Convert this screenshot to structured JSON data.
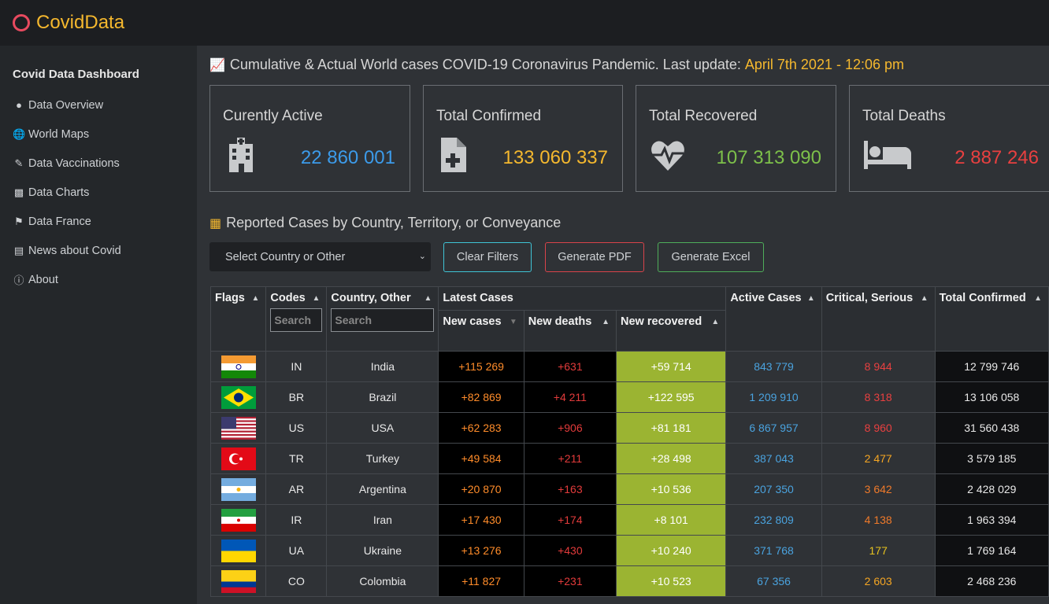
{
  "app": {
    "brand": "CovidData"
  },
  "sidebar": {
    "title": "Covid Data Dashboard",
    "items": [
      {
        "label": "Data Overview",
        "icon": "pills-icon"
      },
      {
        "label": "World Maps",
        "icon": "globe-icon"
      },
      {
        "label": "Data Vaccinations",
        "icon": "syringe-icon"
      },
      {
        "label": "Data Charts",
        "icon": "chart-bar-icon"
      },
      {
        "label": "Data France",
        "icon": "flag-icon"
      },
      {
        "label": "News about Covid",
        "icon": "newspaper-icon"
      },
      {
        "label": "About",
        "icon": "info-icon"
      }
    ]
  },
  "headline": {
    "text": "Cumulative & Actual World cases COVID-19 Coronavirus Pandemic. Last update:",
    "date": "April 7th 2021 - 12:06 pm"
  },
  "cards": [
    {
      "title": "Curently Active",
      "value": "22 860 001",
      "color": "#3c9bea",
      "icon": "hospital-icon"
    },
    {
      "title": "Total Confirmed",
      "value": "133 060 337",
      "color": "#f5b82e",
      "icon": "file-medical-icon"
    },
    {
      "title": "Total Recovered",
      "value": "107 313 090",
      "color": "#7dc04a",
      "icon": "heartbeat-icon"
    },
    {
      "title": "Total Deaths",
      "value": "2 887 246",
      "color": "#e84040",
      "icon": "bed-icon"
    }
  ],
  "section": {
    "title": "Reported Cases by Country, Territory, or Conveyance"
  },
  "controls": {
    "select_placeholder": "Select Country or Other",
    "clear_filters": "Clear Filters",
    "generate_pdf": "Generate PDF",
    "generate_excel": "Generate Excel"
  },
  "table": {
    "headers": {
      "flags": "Flags",
      "codes": "Codes",
      "country": "Country, Other",
      "latest": "Latest Cases",
      "new_cases": "New cases",
      "new_deaths": "New deaths",
      "new_recovered": "New recovered",
      "active": "Active Cases",
      "critical": "Critical, Serious",
      "total": "Total Confirmed"
    },
    "search_placeholder": "Search",
    "rows": [
      {
        "flag": "india",
        "code": "IN",
        "country": "India",
        "new_cases": "+115 269",
        "new_deaths": "+631",
        "new_recovered": "+59 714",
        "active": "843 779",
        "critical": "8 944",
        "critical_color": "#e84040",
        "total": "12 799 746"
      },
      {
        "flag": "brazil",
        "code": "BR",
        "country": "Brazil",
        "new_cases": "+82 869",
        "new_deaths": "+4 211",
        "new_recovered": "+122 595",
        "active": "1 209 910",
        "critical": "8 318",
        "critical_color": "#e84040",
        "total": "13 106 058"
      },
      {
        "flag": "usa",
        "code": "US",
        "country": "USA",
        "new_cases": "+62 283",
        "new_deaths": "+906",
        "new_recovered": "+81 181",
        "active": "6 867 957",
        "critical": "8 960",
        "critical_color": "#e84040",
        "total": "31 560 438"
      },
      {
        "flag": "turkey",
        "code": "TR",
        "country": "Turkey",
        "new_cases": "+49 584",
        "new_deaths": "+211",
        "new_recovered": "+28 498",
        "active": "387 043",
        "critical": "2 477",
        "critical_color": "#f5a623",
        "total": "3 579 185"
      },
      {
        "flag": "argentina",
        "code": "AR",
        "country": "Argentina",
        "new_cases": "+20 870",
        "new_deaths": "+163",
        "new_recovered": "+10 536",
        "active": "207 350",
        "critical": "3 642",
        "critical_color": "#f07a2a",
        "total": "2 428 029"
      },
      {
        "flag": "iran",
        "code": "IR",
        "country": "Iran",
        "new_cases": "+17 430",
        "new_deaths": "+174",
        "new_recovered": "+8 101",
        "active": "232 809",
        "critical": "4 138",
        "critical_color": "#f07a2a",
        "total": "1 963 394"
      },
      {
        "flag": "ukraine",
        "code": "UA",
        "country": "Ukraine",
        "new_cases": "+13 276",
        "new_deaths": "+430",
        "new_recovered": "+10 240",
        "active": "371 768",
        "critical": "177",
        "critical_color": "#e6c21f",
        "total": "1 769 164"
      },
      {
        "flag": "colombia",
        "code": "CO",
        "country": "Colombia",
        "new_cases": "+11 827",
        "new_deaths": "+231",
        "new_recovered": "+10 523",
        "active": "67 356",
        "critical": "2 603",
        "critical_color": "#f5a623",
        "total": "2 468 236"
      }
    ]
  }
}
